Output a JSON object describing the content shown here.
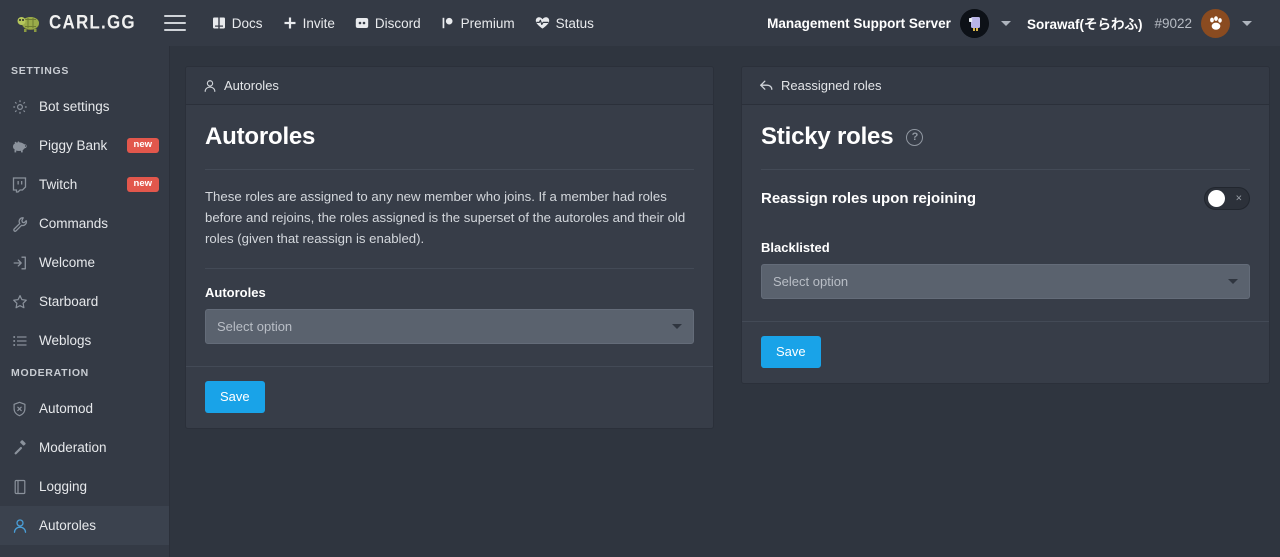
{
  "topbar": {
    "brand": "CARL.GG",
    "brand_logo_icon": "turtle-icon",
    "menu_icon": "hamburger-icon",
    "nav": [
      {
        "label": "Docs",
        "icon": "book-icon"
      },
      {
        "label": "Invite",
        "icon": "plus-icon"
      },
      {
        "label": "Discord",
        "icon": "discord-icon"
      },
      {
        "label": "Premium",
        "icon": "lollipop-icon"
      },
      {
        "label": "Status",
        "icon": "heartbeat-icon"
      }
    ],
    "server_name": "Management Support Server",
    "server_avatar_icon": "server-avatar",
    "user_name": "Sorawaf(そらわふ)",
    "user_discriminator": "#9022",
    "user_avatar_icon": "paw-avatar",
    "dropdown_caret_icon": "chevron-down-icon"
  },
  "sidebar": {
    "sections": [
      {
        "title": "SETTINGS",
        "items": [
          {
            "label": "Bot settings",
            "icon": "gear-icon",
            "badge": null,
            "active": false
          },
          {
            "label": "Piggy Bank",
            "icon": "piggy-bank-icon",
            "badge": "new",
            "active": false
          },
          {
            "label": "Twitch",
            "icon": "twitch-icon",
            "badge": "new",
            "active": false
          },
          {
            "label": "Commands",
            "icon": "wrench-icon",
            "badge": null,
            "active": false
          },
          {
            "label": "Welcome",
            "icon": "sign-in-icon",
            "badge": null,
            "active": false
          },
          {
            "label": "Starboard",
            "icon": "star-icon",
            "badge": null,
            "active": false
          },
          {
            "label": "Weblogs",
            "icon": "list-icon",
            "badge": null,
            "active": false
          }
        ]
      },
      {
        "title": "MODERATION",
        "items": [
          {
            "label": "Automod",
            "icon": "shield-x-icon",
            "badge": null,
            "active": false
          },
          {
            "label": "Moderation",
            "icon": "gavel-icon",
            "badge": null,
            "active": false
          },
          {
            "label": "Logging",
            "icon": "book-closed-icon",
            "badge": null,
            "active": false
          },
          {
            "label": "Autoroles",
            "icon": "user-icon",
            "badge": null,
            "active": true
          }
        ]
      }
    ]
  },
  "autoroles_card": {
    "header_label": "Autoroles",
    "header_icon": "user-icon",
    "title": "Autoroles",
    "description": "These roles are assigned to any new member who joins. If a member had roles before and rejoins, the roles assigned is the superset of the autoroles and their old roles (given that reassign is enabled).",
    "field_label": "Autoroles",
    "select_placeholder": "Select option",
    "save_label": "Save"
  },
  "sticky_card": {
    "header_label": "Reassigned roles",
    "header_icon": "reply-arrow-icon",
    "title": "Sticky roles",
    "help_icon": "question-mark-icon",
    "help_glyph": "?",
    "toggle_label": "Reassign roles upon rejoining",
    "toggle_state": "off",
    "toggle_off_glyph": "×",
    "field_label": "Blacklisted",
    "select_placeholder": "Select option",
    "save_label": "Save"
  },
  "colors": {
    "page_bg": "#2f353f",
    "panel_bg": "#343a45",
    "card_bg": "#373d48",
    "accent_blue": "#19a3e8",
    "active_blue": "#4a9fd8",
    "badge_red": "#e2574c",
    "select_bg": "#5a626e"
  }
}
